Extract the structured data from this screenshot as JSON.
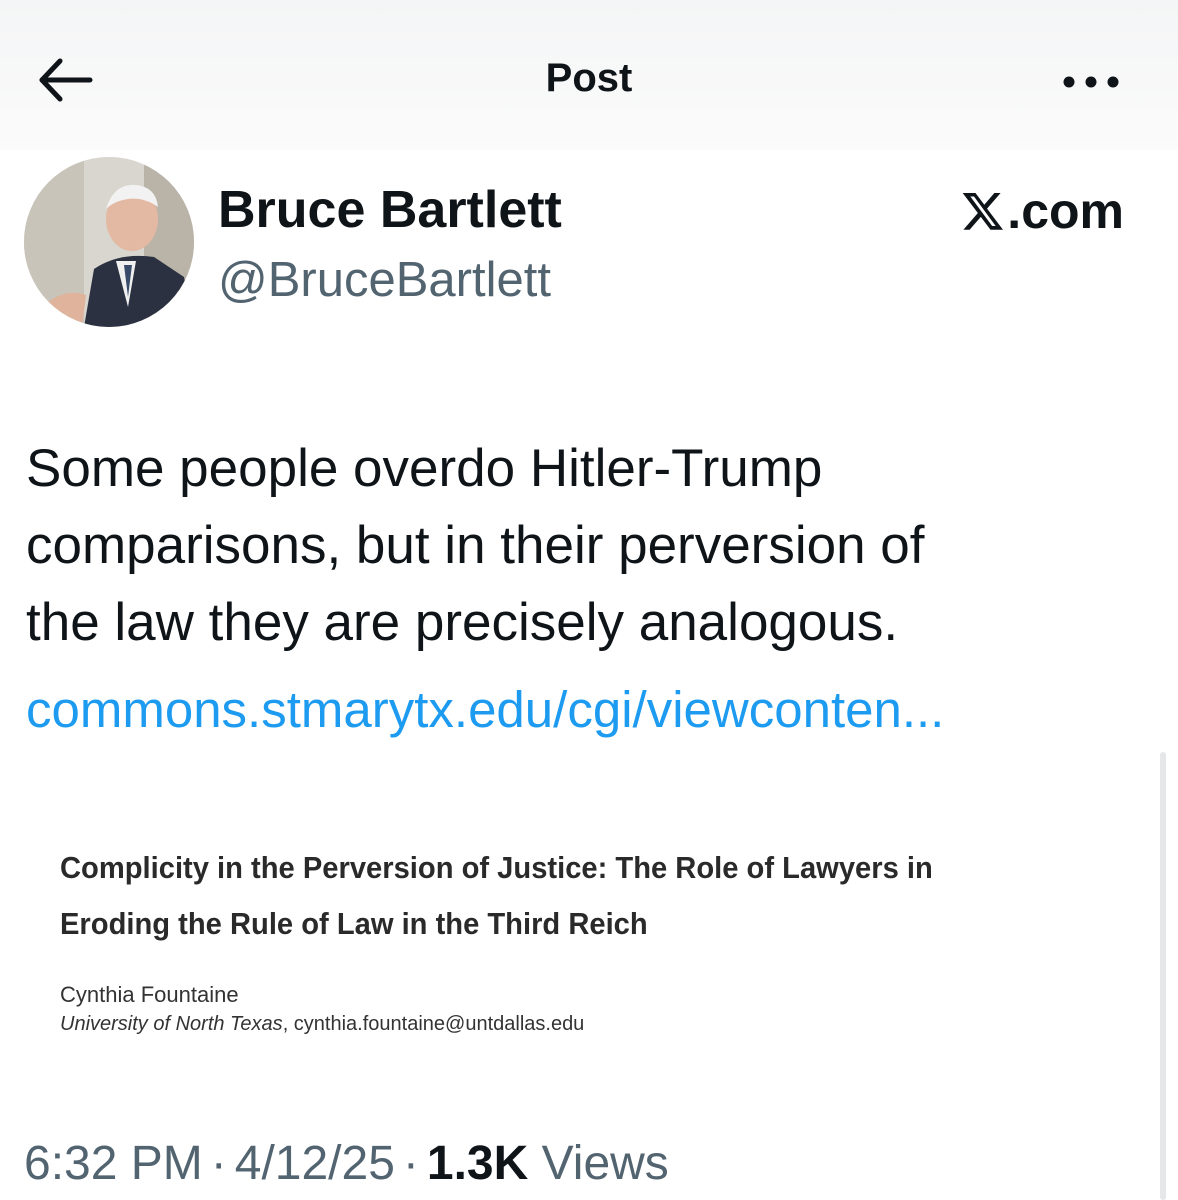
{
  "header": {
    "title": "Post"
  },
  "author": {
    "name": "Bruce Bartlett",
    "handle": "@BruceBartlett"
  },
  "source_badge": {
    "text": ".com"
  },
  "post": {
    "lines": [
      "Some people overdo Hitler-Trump",
      "comparisons, but in their perversion of",
      "the law they are precisely analogous."
    ],
    "link": "commons.stmarytx.edu/cgi/viewconten..."
  },
  "card": {
    "title_lines": [
      "Complicity in the Perversion of Justice: The Role of Lawyers in",
      "Eroding the Rule of Law in the Third Reich"
    ],
    "author": "Cynthia Fountaine",
    "affiliation": "University of North Texas",
    "email": ", cynthia.fountaine@untdallas.edu"
  },
  "meta": {
    "time": "6:32 PM",
    "date": "4/12/25",
    "separator": "·",
    "views_count": "1.3K",
    "views_label": "Views"
  },
  "colors": {
    "text": "#0f1419",
    "secondary": "#536471",
    "link": "#1d9bf0"
  }
}
